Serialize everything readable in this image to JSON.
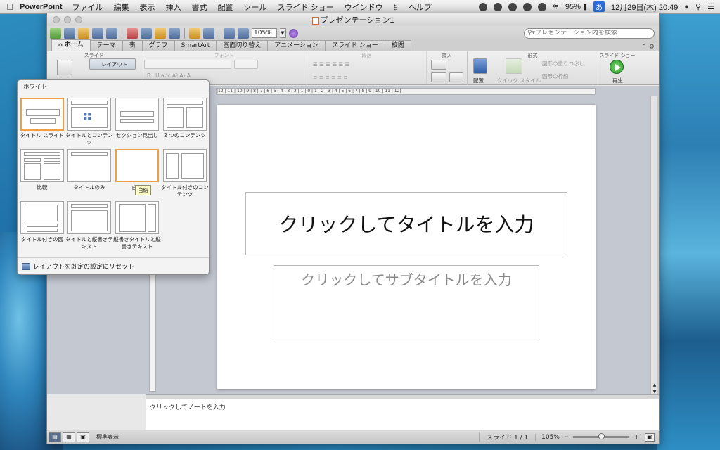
{
  "menubar": {
    "app": "PowerPoint",
    "items": [
      "ファイル",
      "編集",
      "表示",
      "挿入",
      "書式",
      "配置",
      "ツール",
      "スライド ショー",
      "ウインドウ",
      "ヘルプ"
    ],
    "battery": "95%",
    "ime": "あ",
    "datetime": "12月29日(木)  20:49"
  },
  "window": {
    "title": "プレゼンテーション1",
    "zoom_value": "105%",
    "search_placeholder": "プレゼンテーション内を検索"
  },
  "ribbon": {
    "tabs": [
      "ホーム",
      "テーマ",
      "表",
      "グラフ",
      "SmartArt",
      "画面切り替え",
      "アニメーション",
      "スライド ショー",
      "校閲"
    ],
    "groups": {
      "slide": "スライド",
      "font": "フォント",
      "paragraph": "段落",
      "insert": "挿入",
      "format": "形式",
      "slideshow": "スライド ショー"
    },
    "layout_button": "レイアウト",
    "arrange": "配置",
    "quick_style": "クイック スタイル",
    "shape_fill": "図形の塗りつぶし",
    "shape_line": "図形の枠線",
    "play": "再生"
  },
  "slide": {
    "title_placeholder": "クリックしてタイトルを入力",
    "subtitle_placeholder": "クリックしてサブタイトルを入力"
  },
  "notes": {
    "placeholder": "クリックしてノートを入力"
  },
  "status": {
    "view": "標準表示",
    "slide_label": "スライド 1 / 1",
    "zoom": "105%"
  },
  "layout_panel": {
    "header": "ホワイト",
    "layouts": [
      "タイトル スライド",
      "タイトルとコンテンツ",
      "セクション見出し",
      "2 つのコンテンツ",
      "比較",
      "タイトルのみ",
      "白紙",
      "タイトル付きのコンテンツ",
      "タイトル付きの図",
      "タイトルと縦書きテキスト",
      "縦書きタイトルと縦書きテキスト"
    ],
    "tooltip": "白紙",
    "reset": "レイアウトを既定の設定にリセット"
  }
}
